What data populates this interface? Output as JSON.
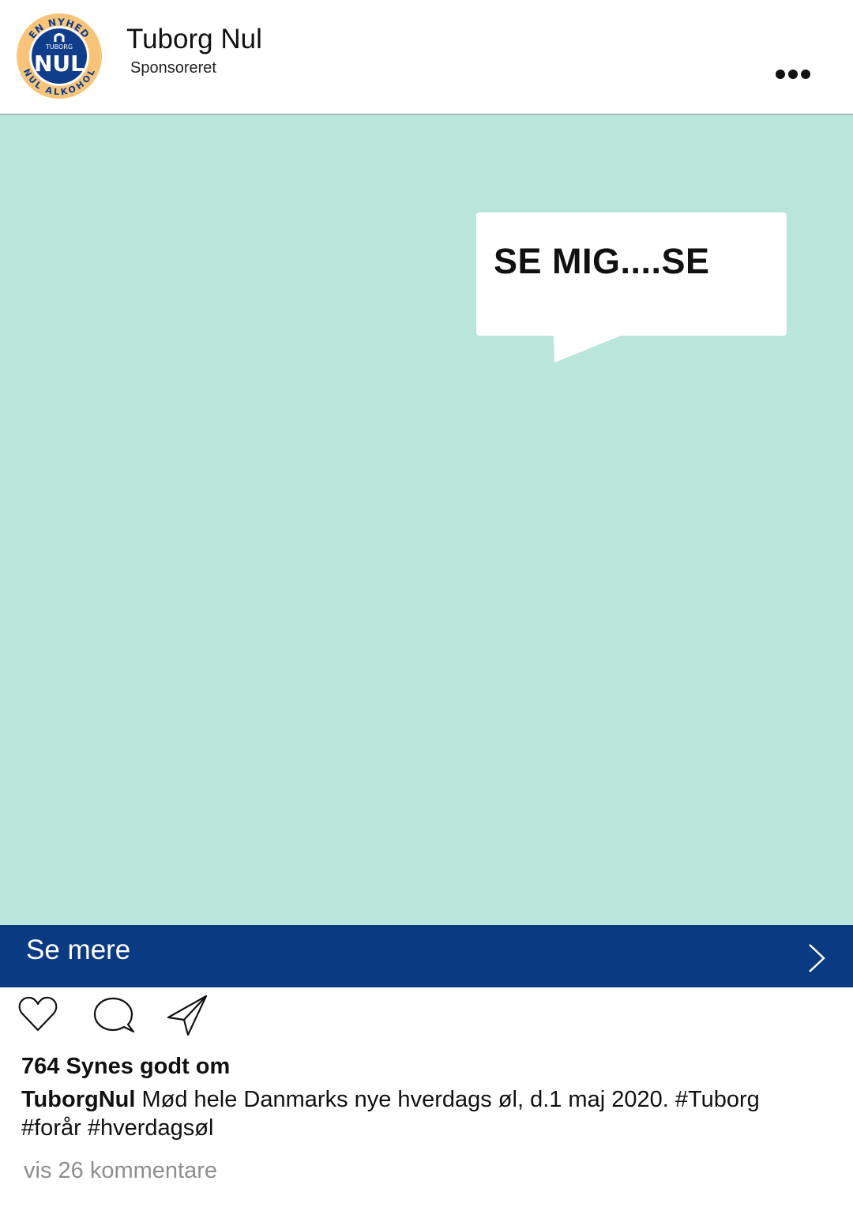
{
  "header": {
    "account_name": "Tuborg Nul",
    "sponsored_label": "Sponsoreret",
    "logo": {
      "ring_top": "EN NYHED",
      "ring_bottom": "NUL ALKOHOL",
      "brand": "TUBORG",
      "word": "NUL"
    },
    "more_icon": "more-horizontal-icon"
  },
  "media": {
    "background_color": "#bae6d9",
    "speech_bubble_text": "SE MIG....SE"
  },
  "cta": {
    "label": "Se mere",
    "icon": "chevron-right-icon",
    "background_color": "#0a3a82"
  },
  "actions": {
    "like_icon": "heart-icon",
    "comment_icon": "comment-bubble-icon",
    "share_icon": "paper-plane-icon"
  },
  "likes_text": "764 Synes godt om",
  "caption": {
    "username": "TuborgNul",
    "text": " Mød hele Danmarks nye hverdags øl, d.1 maj 2020. #Tuborg #forår #hverdagsøl"
  },
  "comments_link": "vis 26 kommentare"
}
